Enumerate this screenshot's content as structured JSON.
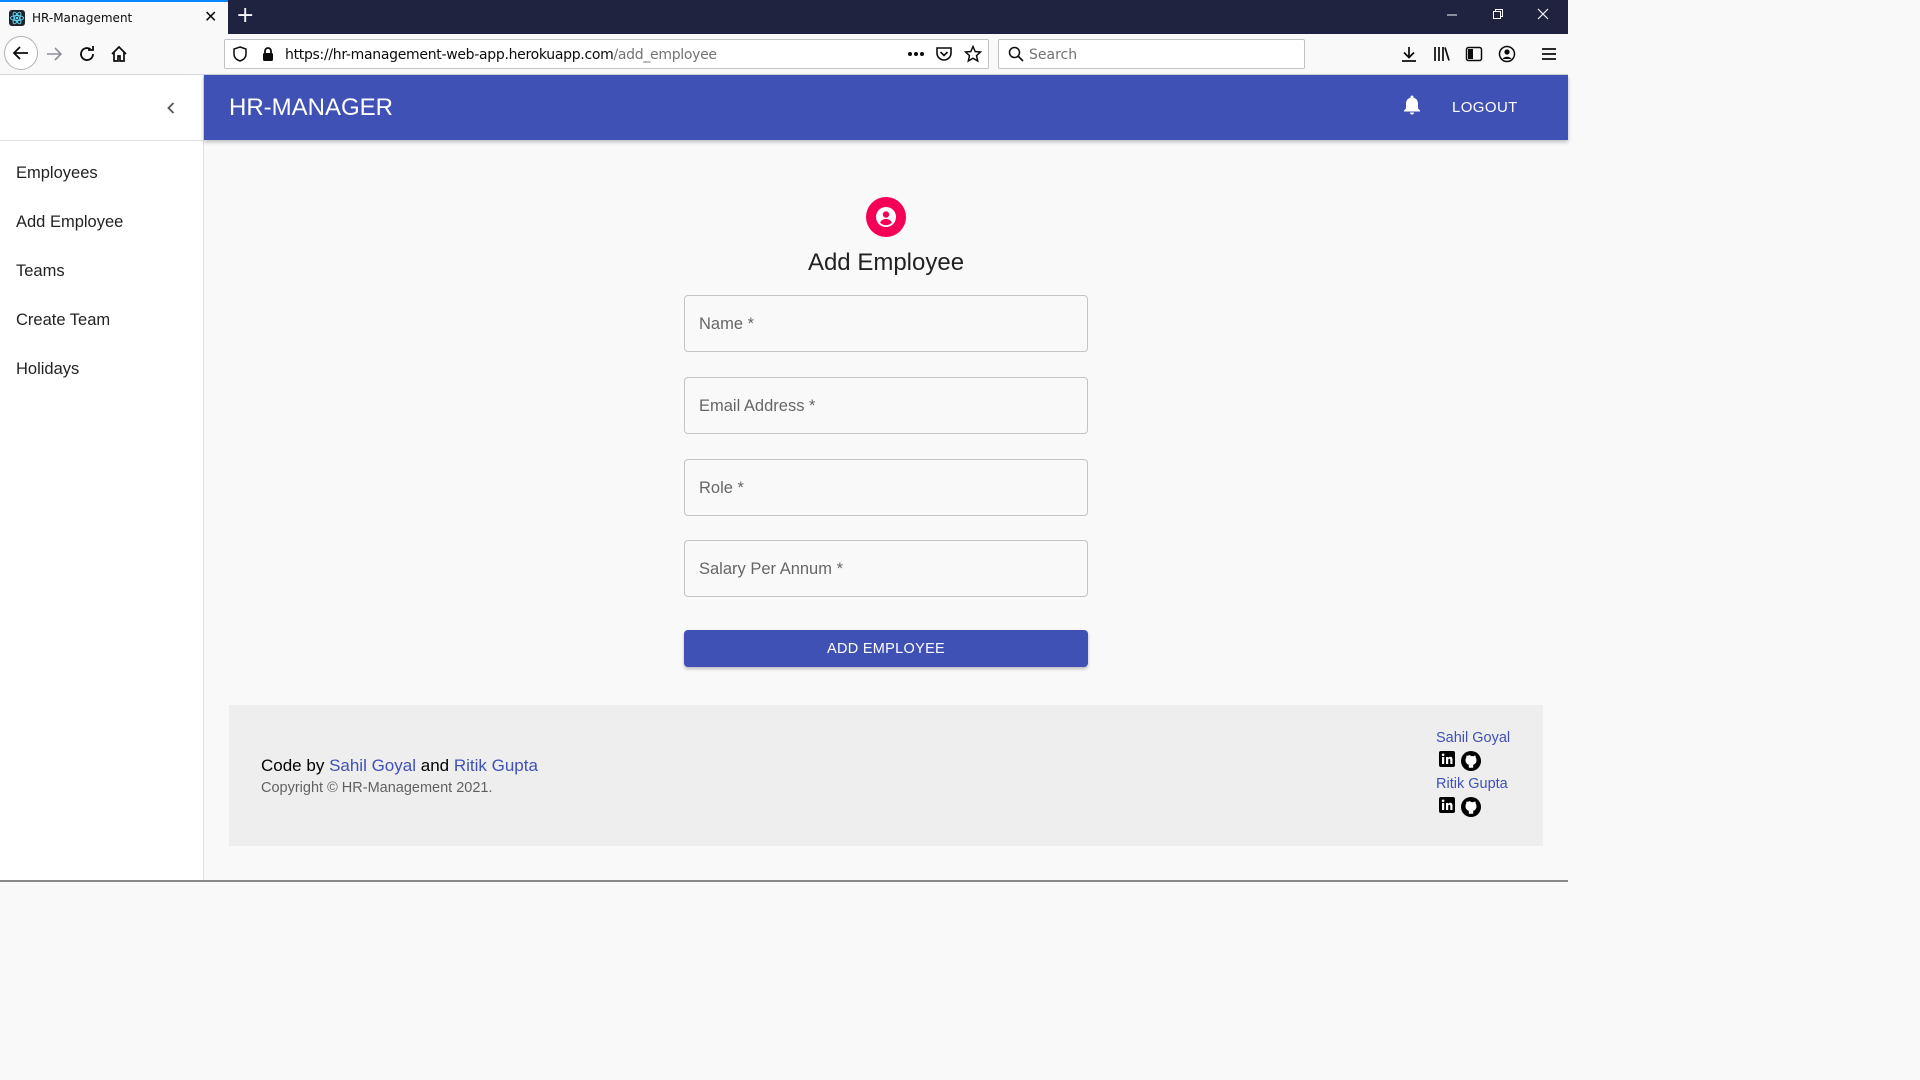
{
  "browser": {
    "tab_title": "HR-Management",
    "url_host": "https://hr-management-web-app.herokuapp.com",
    "url_path": "/add_employee",
    "search_placeholder": "Search"
  },
  "app": {
    "title": "HR-MANAGER",
    "logout_label": "LOGOUT",
    "accent_color": "#3f51b5",
    "avatar_color": "#f50057"
  },
  "sidebar": {
    "items": [
      {
        "label": "Employees"
      },
      {
        "label": "Add Employee"
      },
      {
        "label": "Teams"
      },
      {
        "label": "Create Team"
      },
      {
        "label": "Holidays"
      }
    ]
  },
  "form": {
    "title": "Add Employee",
    "fields": [
      {
        "label": "Name *"
      },
      {
        "label": "Email Address *"
      },
      {
        "label": "Role *"
      },
      {
        "label": "Salary Per Annum *"
      }
    ],
    "submit_label": "ADD EMPLOYEE"
  },
  "footer": {
    "code_by": "Code by",
    "author1": "Sahil Goyal",
    "and": "and",
    "author2": "Ritik Gupta",
    "copyright": "Copyright © HR-Management 2021.",
    "links": [
      {
        "name": "Sahil Goyal",
        "icons": [
          "linkedin-icon",
          "github-icon"
        ]
      },
      {
        "name": "Ritik Gupta",
        "icons": [
          "linkedin-icon",
          "github-icon"
        ]
      }
    ]
  }
}
